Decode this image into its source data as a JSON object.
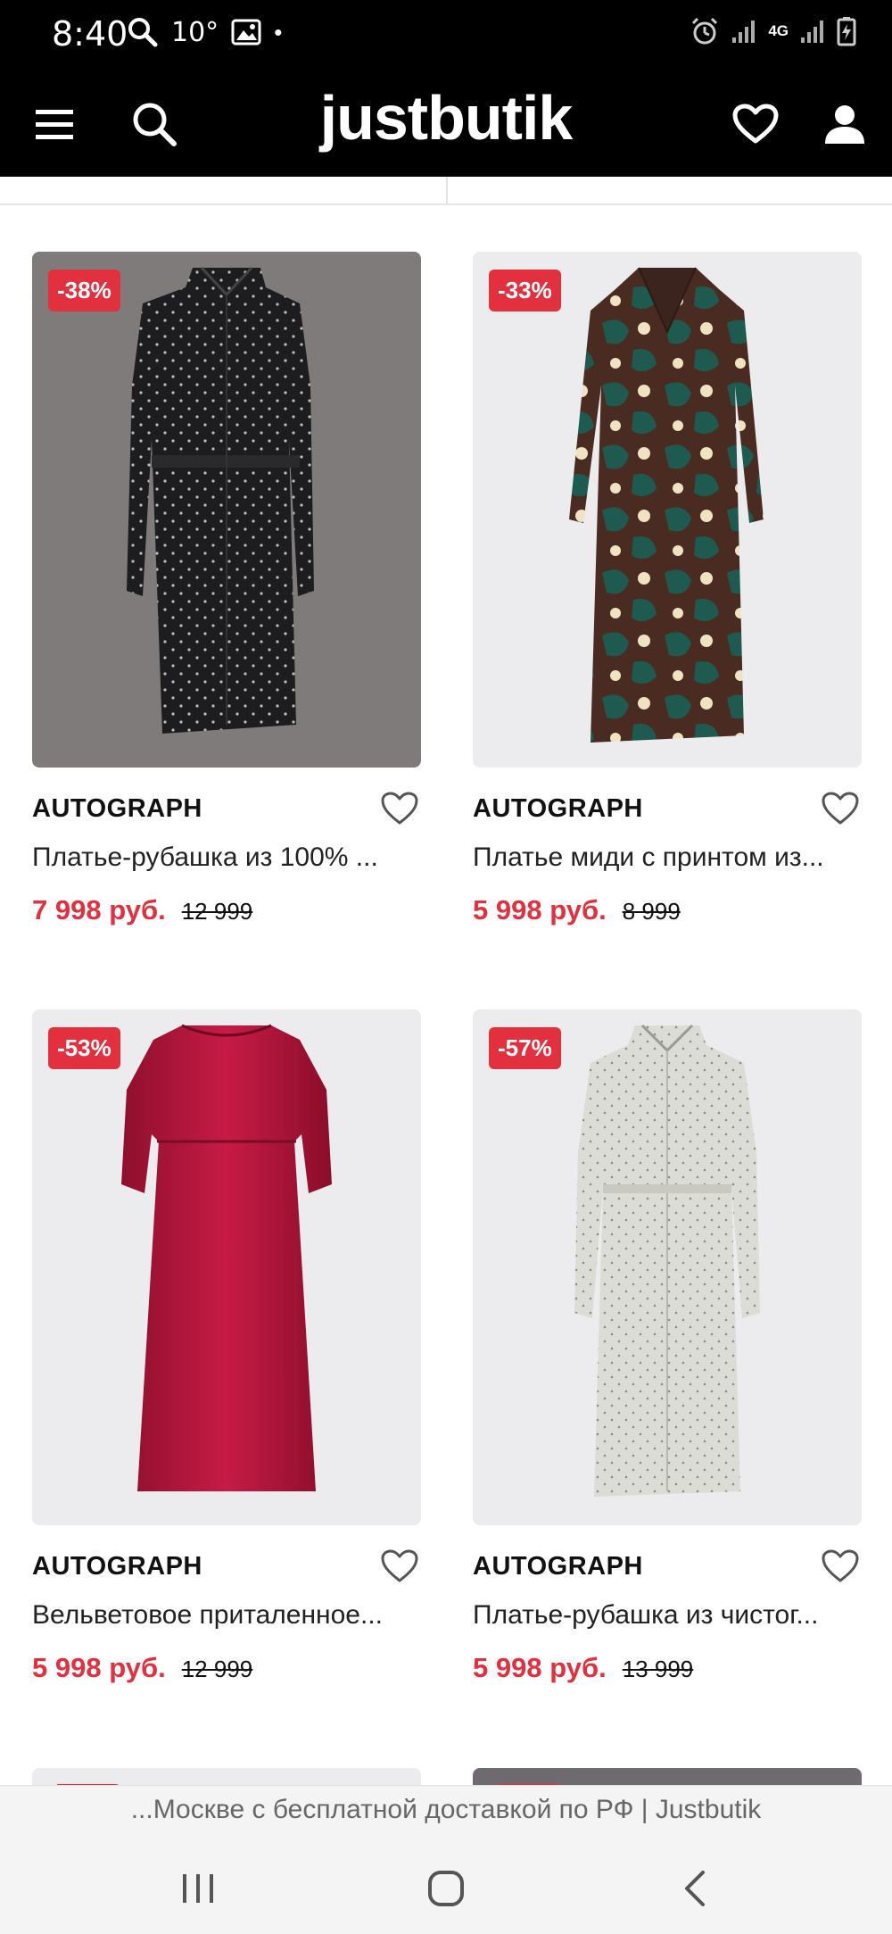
{
  "status_bar": {
    "time": "8:40",
    "temperature": "10°",
    "network_type": "4G",
    "dot": "•",
    "icons": [
      "search-icon",
      "image-icon",
      "alarm-icon",
      "signal-icon",
      "battery-icon"
    ]
  },
  "header": {
    "logo": "justbutik",
    "icons": [
      "menu-icon",
      "search-icon",
      "heart-icon",
      "user-icon"
    ]
  },
  "products": [
    {
      "discount": "-38%",
      "brand": "AUTOGRAPH",
      "name": "Платье-рубашка из 100% ...",
      "price": "7 998 руб.",
      "old_price": "12 999"
    },
    {
      "discount": "-33%",
      "brand": "AUTOGRAPH",
      "name": "Платье миди с принтом из...",
      "price": "5 998 руб.",
      "old_price": "8 999"
    },
    {
      "discount": "-53%",
      "brand": "AUTOGRAPH",
      "name": "Вельветовое приталенное...",
      "price": "5 998 руб.",
      "old_price": "12 999"
    },
    {
      "discount": "-57%",
      "brand": "AUTOGRAPH",
      "name": "Платье-рубашка из чистог...",
      "price": "5 998 руб.",
      "old_price": "13 999"
    }
  ],
  "page_bar": {
    "title": "...Москве с бесплатной доставкой по РФ | Justbutik"
  },
  "colors": {
    "accent_red": "#e2303e",
    "header_bg": "#000000",
    "card_bg_dark": "#807b7b",
    "card_bg_light": "#ececee"
  }
}
